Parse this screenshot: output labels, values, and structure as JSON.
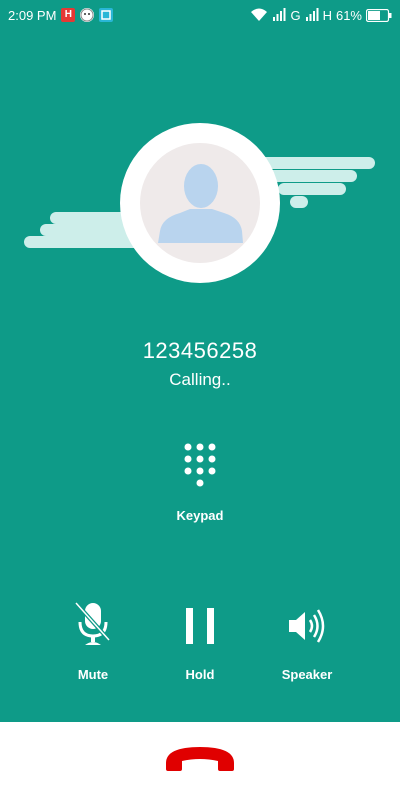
{
  "status_bar": {
    "time": "2:09 PM",
    "network_1": "G",
    "network_2": "H",
    "battery_percent": "61%",
    "notification_icons": [
      "h-app-icon",
      "face-icon",
      "app-icon"
    ]
  },
  "call": {
    "number": "123456258",
    "status": "Calling.."
  },
  "controls": {
    "keypad_label": "Keypad",
    "mute_label": "Mute",
    "hold_label": "Hold",
    "speaker_label": "Speaker"
  },
  "colors": {
    "background": "#0e9b88",
    "cloud": "#cdeeea",
    "avatar_silhouette": "#b9d4ee",
    "end_call": "#e00000"
  },
  "icons": {
    "keypad": "dialpad-icon",
    "mute": "mic-off-icon",
    "hold": "pause-icon",
    "speaker": "speaker-icon",
    "end_call": "end-call-icon"
  }
}
